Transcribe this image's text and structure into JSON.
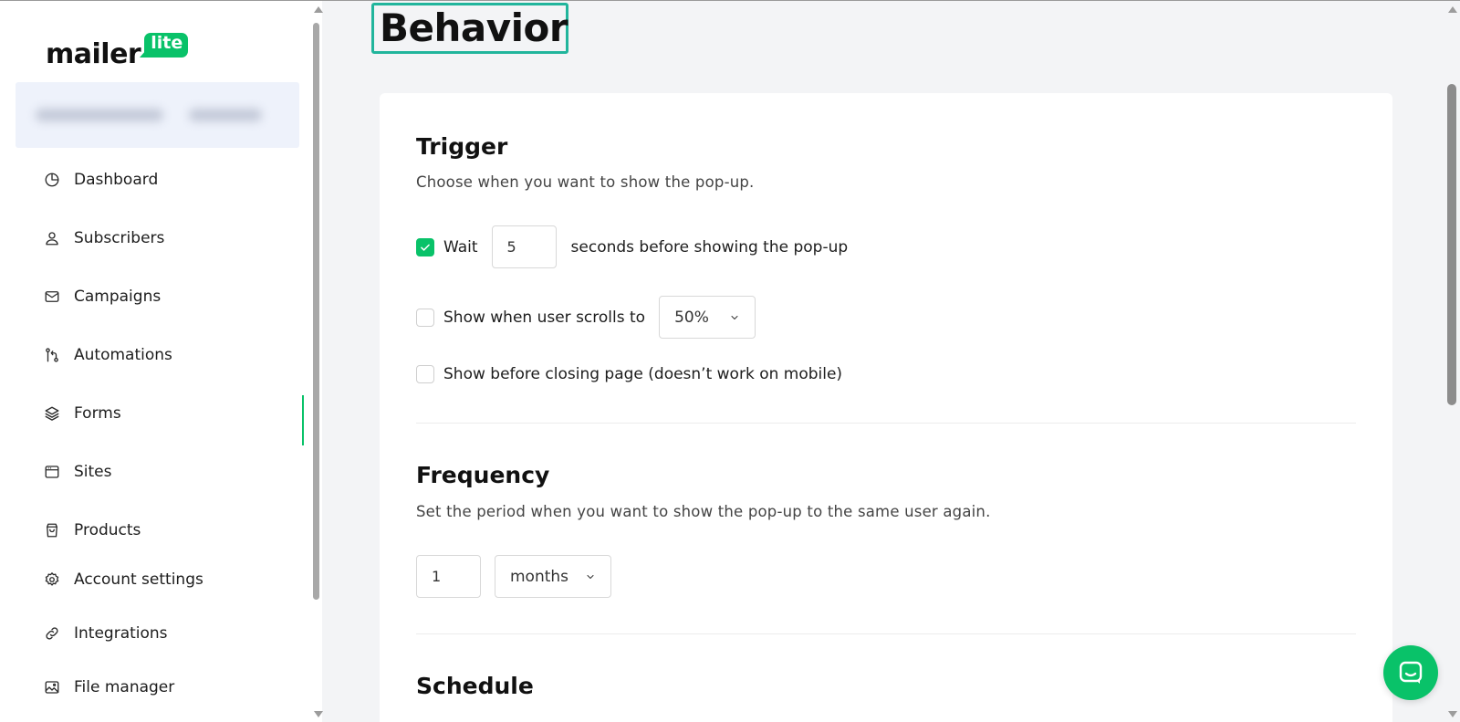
{
  "logo": {
    "word": "mailer",
    "badge": "lite"
  },
  "sidebar": {
    "items": [
      {
        "label": "Dashboard",
        "icon": "clock-icon"
      },
      {
        "label": "Subscribers",
        "icon": "user-icon"
      },
      {
        "label": "Campaigns",
        "icon": "mail-icon"
      },
      {
        "label": "Automations",
        "icon": "flow-icon"
      },
      {
        "label": "Forms",
        "icon": "layers-icon",
        "active": true
      },
      {
        "label": "Sites",
        "icon": "browser-icon"
      },
      {
        "label": "Products",
        "icon": "shopping-bag-icon"
      },
      {
        "label": "Account settings",
        "icon": "gear-icon"
      },
      {
        "label": "Integrations",
        "icon": "link-icon"
      },
      {
        "label": "File manager",
        "icon": "image-icon"
      }
    ],
    "active_color": "#09c269"
  },
  "page": {
    "title": "Behavior"
  },
  "trigger": {
    "title": "Trigger",
    "description": "Choose when you want to show the pop-up.",
    "wait": {
      "label": "Wait",
      "checked": true,
      "value": "5",
      "suffix": "seconds before showing the pop-up"
    },
    "scroll": {
      "label": "Show when user scrolls to",
      "checked": false,
      "value": "50%"
    },
    "exit": {
      "label": "Show before closing page (doesn’t work on mobile)",
      "checked": false
    }
  },
  "frequency": {
    "title": "Frequency",
    "description": "Set the period when you want to show the pop-up to the same user again.",
    "value": "1",
    "unit": "months"
  },
  "schedule": {
    "title": "Schedule"
  },
  "colors": {
    "accent": "#09c269",
    "highlight": "#21b59c"
  }
}
